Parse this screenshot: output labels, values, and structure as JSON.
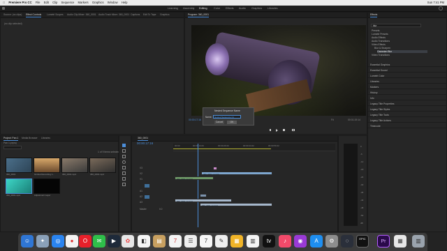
{
  "menubar": {
    "apple": "",
    "app": "Premiere Pro CC",
    "items": [
      "File",
      "Edit",
      "Clip",
      "Sequence",
      "Markers",
      "Graphics",
      "Window",
      "Help"
    ],
    "clock": "Sun 7:41 PM"
  },
  "workspaces": [
    "Learning",
    "Assembly",
    "Editing",
    "Color",
    "Effects",
    "Audio",
    "Graphics",
    "Libraries"
  ],
  "source_tabs": {
    "t1": "Source: (no clips)",
    "t2": "Effect Controls",
    "t3": "Lumetri Scopes",
    "t4": "Audio Clip Mixer: 360_0001",
    "t5": "Audio Track Mixer: 360_0001",
    "t6": "Captions",
    "t7": "Edit To Tape",
    "t8": "Graphics"
  },
  "source_empty": "(no clip selected)",
  "program": {
    "title": "Program: 360_0001",
    "timecode_left": "00:00:17:16",
    "fit": "Fit",
    "timecode_right": "00:01:19:14"
  },
  "dialog": {
    "title": "Nested Sequence Name",
    "name_label": "Name:",
    "name_value": "Nested Sequence 01",
    "cancel": "Cancel",
    "ok": "OK"
  },
  "effects": {
    "tab": "Effects",
    "search": "blur",
    "tree": [
      "Presets",
      "Lumetri Presets",
      "Audio Effects",
      "Audio Transitions",
      "Video Effects",
      "Blur & Sharpen",
      "Gaussian Blur",
      "Video Transitions"
    ],
    "panels": [
      "Essential Graphics",
      "Essential Sound",
      "Lumetri Color",
      "Libraries",
      "Markers",
      "History",
      "Info",
      "Legacy Title Properties",
      "Legacy Title Styles",
      "Legacy Title Tools",
      "Legacy Title Actions",
      "Timecode"
    ]
  },
  "project": {
    "tabs": [
      "Project: Pan 1",
      "Media Browser",
      "Libraries"
    ],
    "project_file": "Pan 1.prproj",
    "items_count": "1 of 9 items selected",
    "thumbs": [
      {
        "label": "360_0001"
      },
      {
        "label": "Gimbal Recording 1..."
      },
      {
        "label": "360_0001.mp4"
      },
      {
        "label": "360_0001.mp4"
      },
      {
        "label": "360_0001.mp4"
      },
      {
        "label": "Adjustment Layer"
      }
    ]
  },
  "timeline": {
    "tab": "360_0001",
    "timecode": "00:00:17:16",
    "ruler": [
      "00:00",
      "00:00:14:23",
      "00:00:29:23",
      "00:00:44:22",
      "00:00:59:22"
    ],
    "tracks": [
      "V3",
      "V2",
      "V1",
      "A1",
      "A2",
      "A3",
      "Master"
    ],
    "master_val": "0.0",
    "clips": {
      "v3": "",
      "v2": "360_0001.mp4 [V]",
      "v1": "360_0001.mp4 [V]",
      "a1": "",
      "a2": "360_0001.mp4 [A]",
      "a3": "360_0001.mp4 [A]"
    }
  },
  "meters": {
    "scale": [
      "0",
      "-6",
      "-12",
      "-18",
      "-24",
      "-30",
      "-36",
      "-42",
      "-48",
      "-54",
      "dB"
    ]
  },
  "colors": {
    "accent": "#4c8ed9",
    "video_clip": "#7ea7cf",
    "audio_clip": "#8fb07f",
    "playhead": "#4c8ed9"
  }
}
